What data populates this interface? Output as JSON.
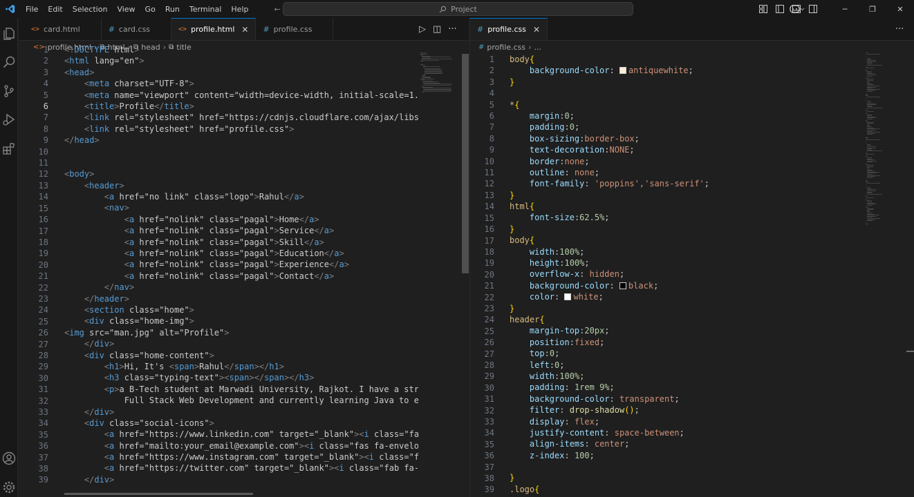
{
  "menu": [
    "File",
    "Edit",
    "Selection",
    "View",
    "Go",
    "Run",
    "Terminal",
    "Help"
  ],
  "search": {
    "label": "Project"
  },
  "left_tabs": [
    {
      "label": "card.html",
      "type": "html"
    },
    {
      "label": "card.css",
      "type": "css"
    },
    {
      "label": "profile.html",
      "type": "html",
      "active": true
    },
    {
      "label": "profile.css",
      "type": "css"
    }
  ],
  "right_tabs": [
    {
      "label": "profile.css",
      "type": "css",
      "active": true
    }
  ],
  "left_breadcrumb": [
    "profile.html",
    "html",
    "head",
    "title"
  ],
  "right_breadcrumb": [
    "profile.css",
    "..."
  ],
  "icons": {
    "explorer": "files-icon",
    "search": "search-icon",
    "source_control": "source-control-icon",
    "run": "run-debug-icon",
    "extensions": "extensions-icon",
    "account": "account-icon",
    "settings": "gear-icon"
  },
  "colors": {
    "accent": "#0078d4",
    "background": "#1f1f1f",
    "bar": "#181818"
  },
  "html_lines": [
    "<!DOCTYPE html>",
    "<html lang=\"en\">",
    "<head>",
    "    <meta charset=\"UTF-8\">",
    "    <meta name=\"viewport\" content=\"width=device-width, initial-scale=1.0\">",
    "    <title>Profile</title>",
    "    <link rel=\"stylesheet\" href=\"https://cdnjs.cloudflare.com/ajax/libs/font-",
    "    <link rel=\"stylesheet\" href=\"profile.css\">",
    "</head>",
    "",
    "",
    "<body>",
    "    <header>",
    "        <a href=\"no link\" class=\"logo\">Rahul</a>",
    "        <nav>",
    "            <a href=\"nolink\" class=\"pagal\">Home</a>",
    "            <a href=\"nolink\" class=\"pagal\">Service</a>",
    "            <a href=\"nolink\" class=\"pagal\">Skill</a>",
    "            <a href=\"nolink\" class=\"pagal\">Education</a>",
    "            <a href=\"nolink\" class=\"pagal\">Experience</a>",
    "            <a href=\"nolink\" class=\"pagal\">Contact</a>",
    "        </nav>",
    "    </header>",
    "    <section class=\"home\">",
    "    <div class=\"home-img\">",
    "<img src=\"man.jpg\" alt=\"Profile\">",
    "    </div>",
    "    <div class=\"home-content\">",
    "        <h1>Hi, It's <span>Rahul</span></h1>",
    "        <h3 class=\"typing-text\"><span></span></h3>",
    "        <p>a B-Tech student at Marwadi University, Rajkot. I have a strong fo",
    "            Full Stack Web Development and currently learning Java to enhance",
    "    </div>",
    "    <div class=\"social-icons\">",
    "        <a href=\"https://www.linkedin.com\" target=\"_blank\"><i class=\"fab fa-l",
    "        <a href=\"mailto:your_email@example.com\"><i class=\"fas fa-envelope\"></",
    "        <a href=\"https://www.instagram.com\" target=\"_blank\"><i class=\"fab fa-",
    "        <a href=\"https://twitter.com\" target=\"_blank\"><i class=\"fab fa-twitte",
    "    </div>"
  ],
  "css_lines": [
    "body{",
    "    background-color: antiquewhite;",
    "}",
    "",
    "*{",
    "    margin:0;",
    "    padding:0;",
    "    box-sizing:border-box;",
    "    text-decoration:NONE;",
    "    border:none;",
    "    outline: none;",
    "    font-family: 'poppins','sans-serif';",
    "}",
    "html{",
    "    font-size:62.5%;",
    "}",
    "body{",
    "    width:100%;",
    "    height:100%;",
    "    overflow-x: hidden;",
    "    background-color: black;",
    "    color: white;",
    "}",
    "header{",
    "    margin-top:20px;",
    "    position:fixed;",
    "    top:0;",
    "    left:0;",
    "    width:100%;",
    "    padding: 1rem 9%;",
    "    background-color: transparent;",
    "    filter: drop-shadow();",
    "    display: flex;",
    "    justify-content: space-between;",
    "    align-items: center;",
    "    z-index: 100;",
    "",
    "}",
    ".logo{"
  ],
  "css_swatches": {
    "2": "#faebd7",
    "21": "#000000",
    "22": "#ffffff"
  }
}
